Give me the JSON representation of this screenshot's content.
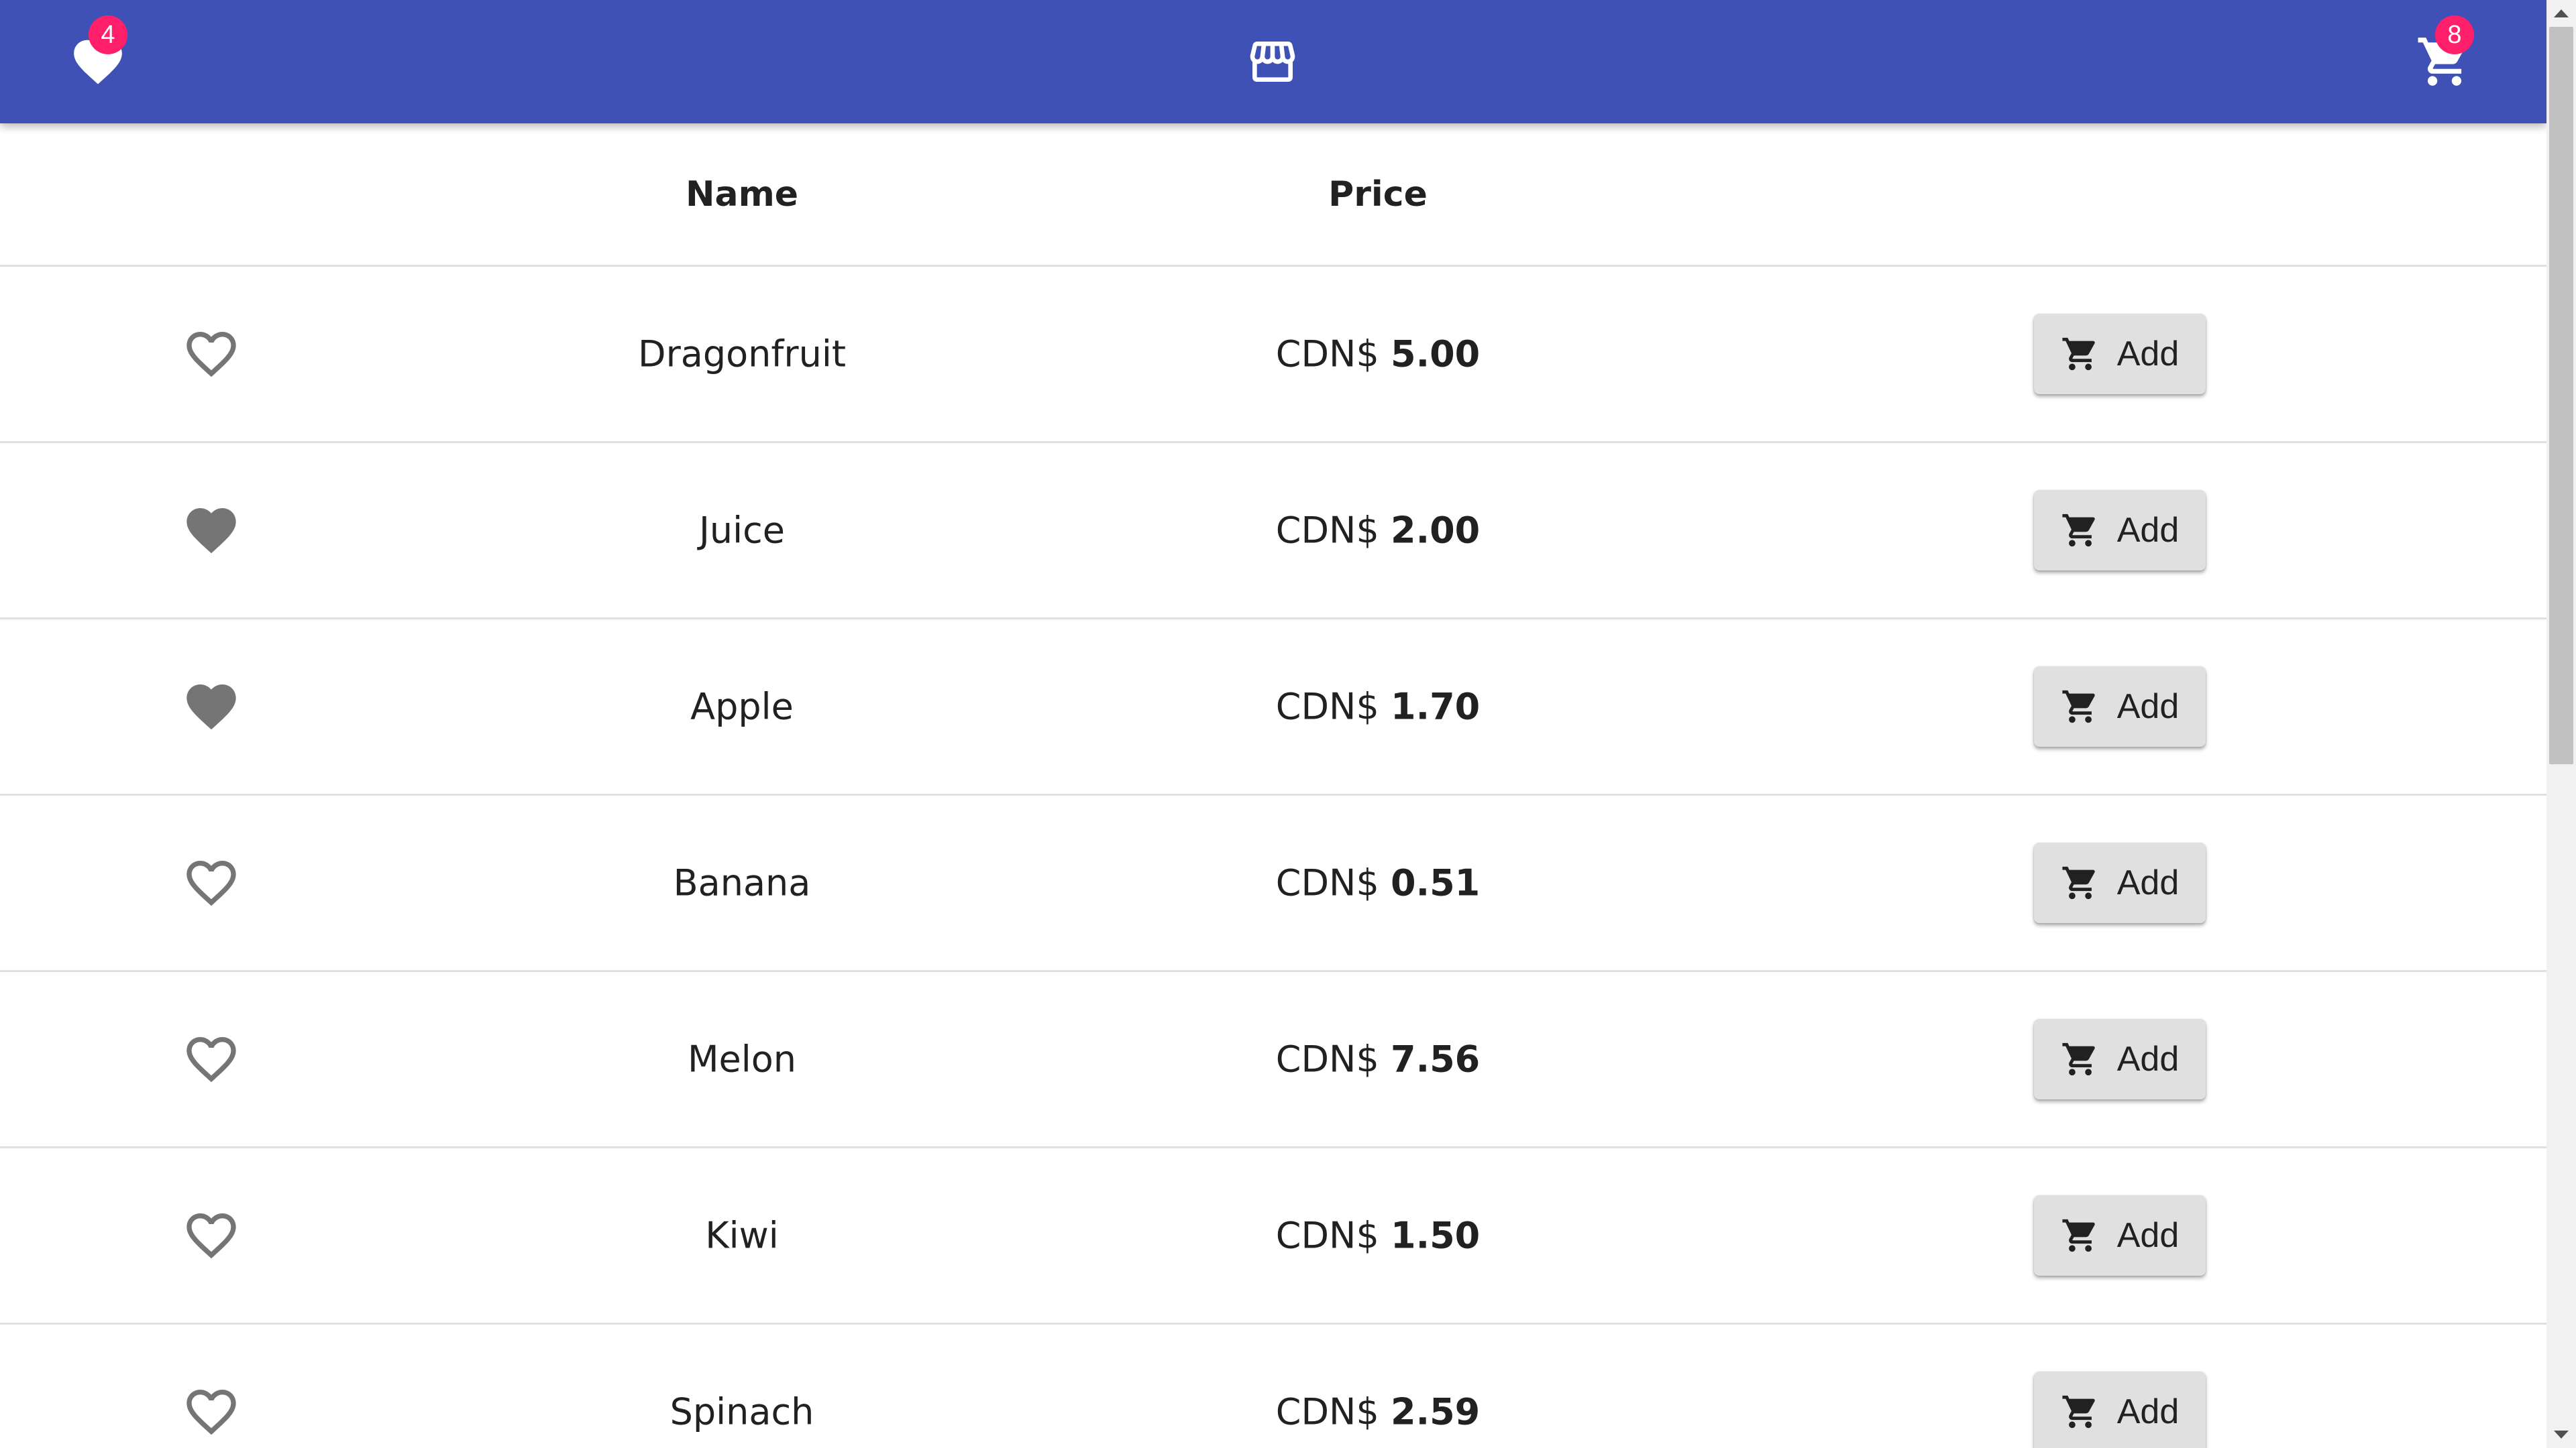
{
  "toolbar": {
    "favorites_icon": "heart-icon",
    "favorites_count": "4",
    "store_icon": "storefront-icon",
    "cart_icon": "shopping-cart-icon",
    "cart_count": "8",
    "background_color": "#3f51b5",
    "badge_color": "#ff1f6b"
  },
  "table": {
    "columns": [
      "",
      "Name",
      "Price",
      ""
    ],
    "currency": "CDN$",
    "add_label": "Add",
    "rows": [
      {
        "favorite": false,
        "name": "Dragonfruit",
        "price": "5.00"
      },
      {
        "favorite": true,
        "name": "Juice",
        "price": "2.00"
      },
      {
        "favorite": true,
        "name": "Apple",
        "price": "1.70"
      },
      {
        "favorite": false,
        "name": "Banana",
        "price": "0.51"
      },
      {
        "favorite": false,
        "name": "Melon",
        "price": "7.56"
      },
      {
        "favorite": false,
        "name": "Kiwi",
        "price": "1.50"
      },
      {
        "favorite": false,
        "name": "Spinach",
        "price": "2.59"
      }
    ]
  },
  "icons": {
    "favorite_filled": "favorite-filled-icon",
    "favorite_outline": "favorite-outline-icon",
    "add_to_cart": "add-shopping-cart-icon"
  }
}
